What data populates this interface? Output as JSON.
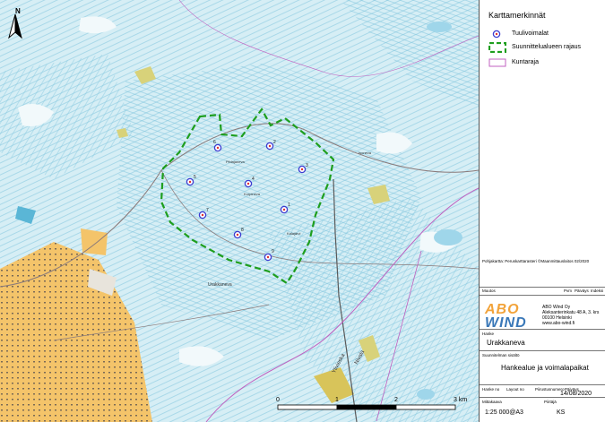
{
  "legend": {
    "title": "Karttamerkinnät",
    "items": [
      {
        "label": "Tuulivoimalat",
        "symbol": "turbine-marker-icon",
        "color": "#3b3bd1"
      },
      {
        "label": "Suunnittelualueen rajaus",
        "symbol": "dashed-boundary-icon",
        "color": "#1e9e1e"
      },
      {
        "label": "Kuntaraja",
        "symbol": "municipal-border-icon",
        "color": "#c060c0"
      }
    ]
  },
  "credit": "Pohjakartta: Peruskarttarasteri ©Maanmittauslaitos 02/2020",
  "title_block": {
    "muutos_label": "Muutos",
    "pvm_label": "Pvm",
    "piirtaja_label": "Piirtäjä",
    "tarkastaja_label": "Päiväys",
    "index_label": "Indeksi",
    "company": {
      "logo_top": "ABO",
      "logo_bottom": "WIND",
      "name": "ABO Wind Oy",
      "street": "Aleksanterinkatu 48 A, 3. krs",
      "city": "00100 Helsinki",
      "web": "www.abo-wind.fi"
    },
    "hanke_label": "Hanke",
    "hanke_value": "Urakkaneva",
    "content_label": "Suunnitelman sisältö",
    "content_value": "Hankealue ja voimalapaikat",
    "hanke_no_label": "Hanke no",
    "layout_label": "Layout no",
    "piirustus_label": "Piirustusnumero",
    "paivays_label": "Päiväys",
    "paivays_value": "14/08/2020",
    "mittakaava_label": "Mittakaava",
    "mittakaava_value": "1:25 000@A3",
    "piirtaja2_label": "Piirtäjä",
    "piirtaja2_value": "KS"
  },
  "scale_bar": {
    "ticks": [
      "0",
      "1",
      "2",
      "3 km"
    ]
  },
  "north_arrow": {
    "label": "N",
    "icon": "north-arrow-icon"
  },
  "turbines": [
    "1",
    "2",
    "3",
    "4",
    "5",
    "6",
    "7",
    "8",
    "9"
  ],
  "map_labels": {
    "urakkaneva": "Urakkaneva",
    "ylivieska": "Ylivieska",
    "nivala": "Nivala",
    "kalajarvi": "Kalajärvi",
    "pihlajaneva": "Pihlajaneva",
    "korpineva": "Korpineva",
    "isoneva": "Isoneva"
  }
}
